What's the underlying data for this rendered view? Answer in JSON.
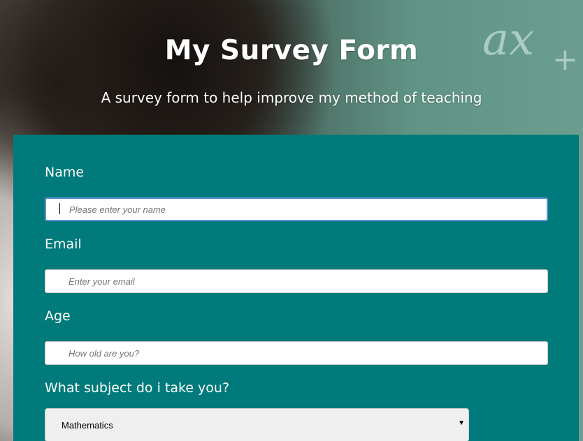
{
  "header": {
    "title": "My Survey Form",
    "subtitle": "A survey form to help improve my method of teaching"
  },
  "form": {
    "name": {
      "label": "Name",
      "placeholder": "Please enter your name",
      "value": ""
    },
    "email": {
      "label": "Email",
      "placeholder": "Enter your email",
      "value": ""
    },
    "age": {
      "label": "Age",
      "placeholder": "How old are you?",
      "value": ""
    },
    "subject": {
      "label": "What subject do i take you?",
      "selected": "Mathematics",
      "arrow_icon": "dropdown-arrow-icon"
    }
  },
  "colors": {
    "form_background": "#007a7a",
    "text": "#ffffff",
    "focus_border": "#5a8fd0"
  }
}
